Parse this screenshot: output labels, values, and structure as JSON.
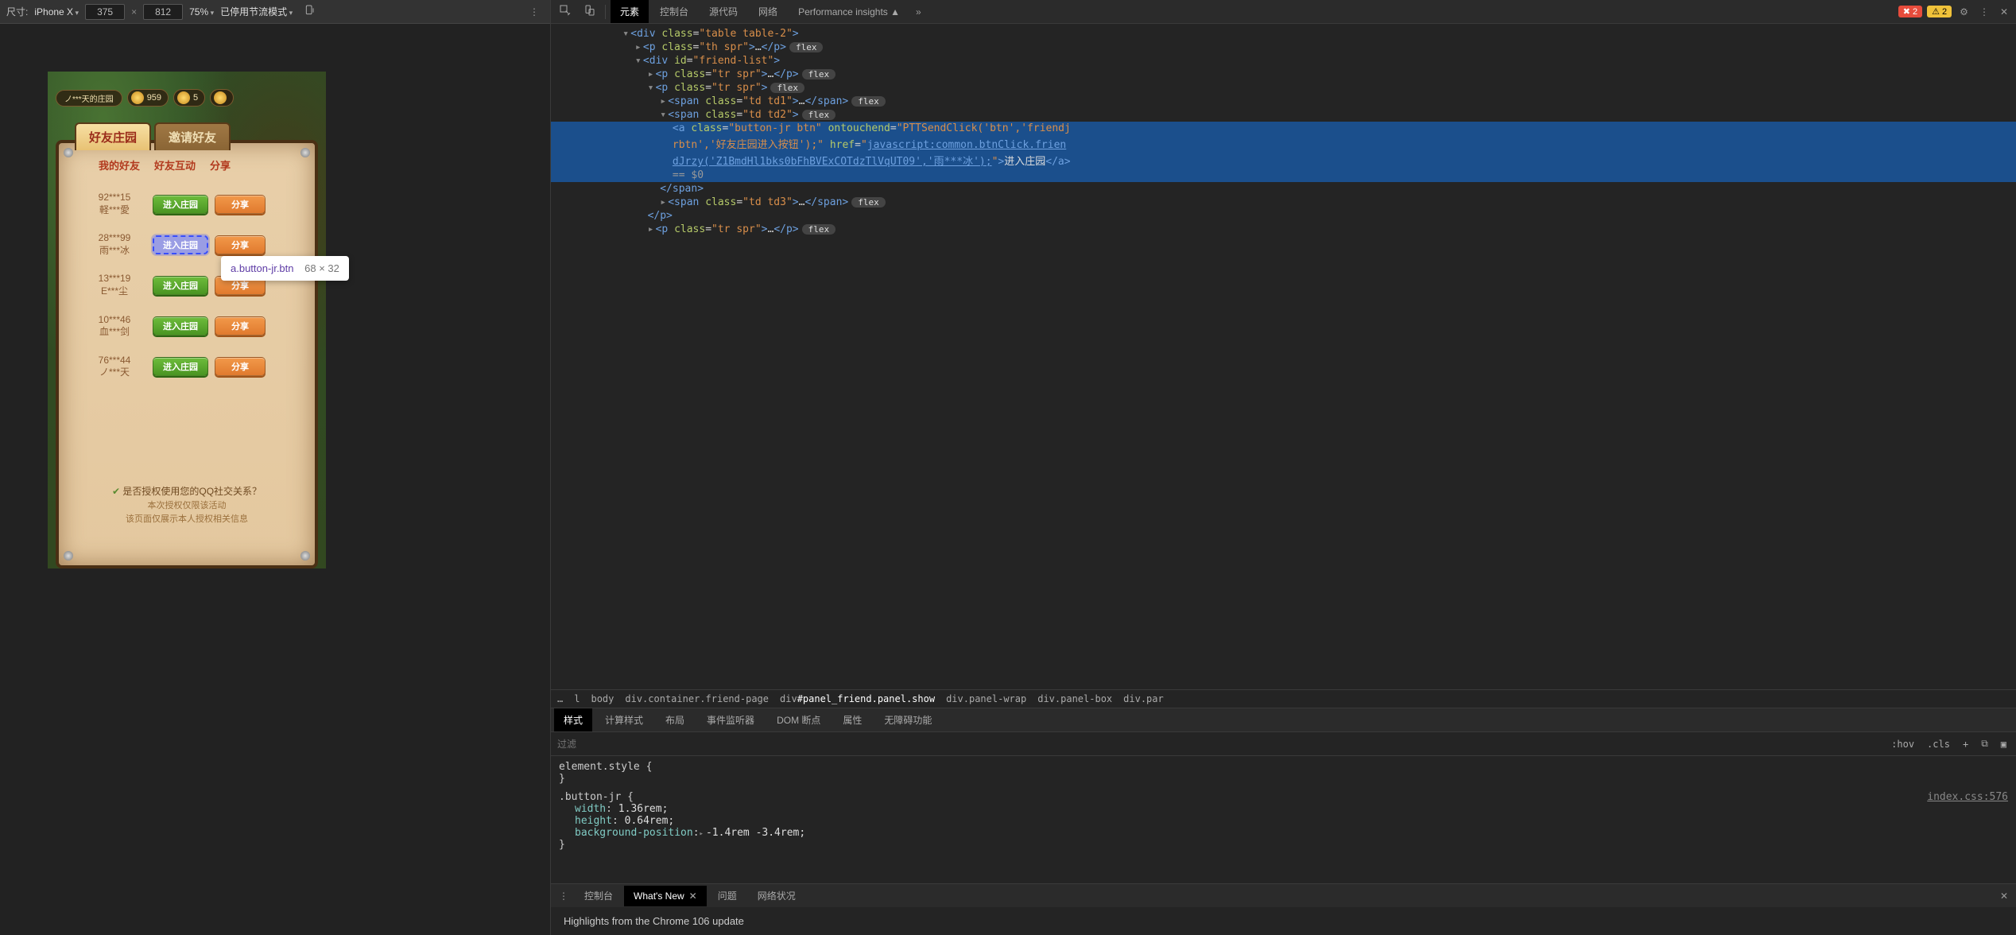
{
  "device_toolbar": {
    "size_label": "尺寸:",
    "device": "iPhone X",
    "width": "375",
    "height": "812",
    "zoom": "75%",
    "throttle": "已停用节流模式"
  },
  "devtools_tabs": {
    "elements": "元素",
    "console": "控制台",
    "sources": "源代码",
    "network": "网络",
    "perf": "Performance insights",
    "errors": "2",
    "warnings": "2"
  },
  "game": {
    "hud_title": "ノ***天的庄园",
    "coin1": "959",
    "coin2": "5",
    "tab_friends": "好友庄园",
    "tab_invite": "邀请好友",
    "subtabs": {
      "my": "我的好友",
      "interact": "好友互动",
      "share": "分享"
    },
    "btn_enter": "进入庄园",
    "btn_share": "分享",
    "rows": [
      {
        "id": "92***15",
        "name": "軽***愛"
      },
      {
        "id": "28***99",
        "name": "雨***冰"
      },
      {
        "id": "13***19",
        "name": "E***尘"
      },
      {
        "id": "10***46",
        "name": "血***剑"
      },
      {
        "id": "76***44",
        "name": "ノ***天"
      }
    ],
    "auth": {
      "q": "是否授权使用您的QQ社交关系？",
      "l1": "本次授权仅限该活动",
      "l2": "该页面仅展示本人授权相关信息"
    }
  },
  "tooltip": {
    "selector": "a.button-jr.btn",
    "dims": "68 × 32"
  },
  "dom": {
    "l0": "<div class=\"table table-2\">",
    "l1": "<p class=\"th spr\">…</p>",
    "l2": "<div id=\"friend-list\">",
    "l3": "<p class=\"tr spr\">…</p>",
    "l4": "<p class=\"tr spr\">",
    "l5": "<span class=\"td td1\">…</span>",
    "l6": "<span class=\"td td2\">",
    "sel_a_open": "<a class=\"button-jr btn\" ontouchend=\"",
    "sel_ontouch": "PTTSendClick('btn','friendjrbtn','好友庄园进入按钮');",
    "sel_href_label": "href=\"",
    "sel_href": "javascript:common.btnClick.friendJrzy('Z1BmdHl1bks0bFhBVExCOTdzTlVqUT09','雨***冰');",
    "sel_close_attr": "\">",
    "sel_text": "进入庄园",
    "sel_close": "</a>",
    "eq0": "== $0",
    "l8": "</span>",
    "l9": "<span class=\"td td3\">…</span>",
    "l10": "</p>",
    "l11": "<p class=\"tr spr\">…</p>",
    "pill": "flex"
  },
  "crumb": {
    "more": "…",
    "l": "l",
    "body": "body",
    "c1": "div.container.friend-page",
    "c2a": "div",
    "c2b": "#panel_friend.panel.show",
    "c3": "div.panel-wrap",
    "c4": "div.panel-box",
    "c5": "div.par"
  },
  "styles_tabs": {
    "styles": "样式",
    "computed": "计算样式",
    "layout": "布局",
    "listeners": "事件监听器",
    "dombp": "DOM 断点",
    "props": "属性",
    "a11y": "无障碍功能"
  },
  "styles_toolbar": {
    "filter_ph": "过滤",
    "hov": ":hov",
    "cls": ".cls"
  },
  "styles": {
    "el": "element.style {",
    "el_close": "}",
    "rule_sel": ".button-jr {",
    "src": "index.css:576",
    "p1n": "width",
    "p1v": "1.36rem;",
    "p2n": "height",
    "p2v": "0.64rem;",
    "p3n": "background-position",
    "p3v": "-1.4rem -3.4rem;",
    "close": "}"
  },
  "drawer": {
    "console": "控制台",
    "whatsnew": "What's New",
    "issues": "问题",
    "netcond": "网络状况",
    "body": "Highlights from the Chrome 106 update"
  }
}
